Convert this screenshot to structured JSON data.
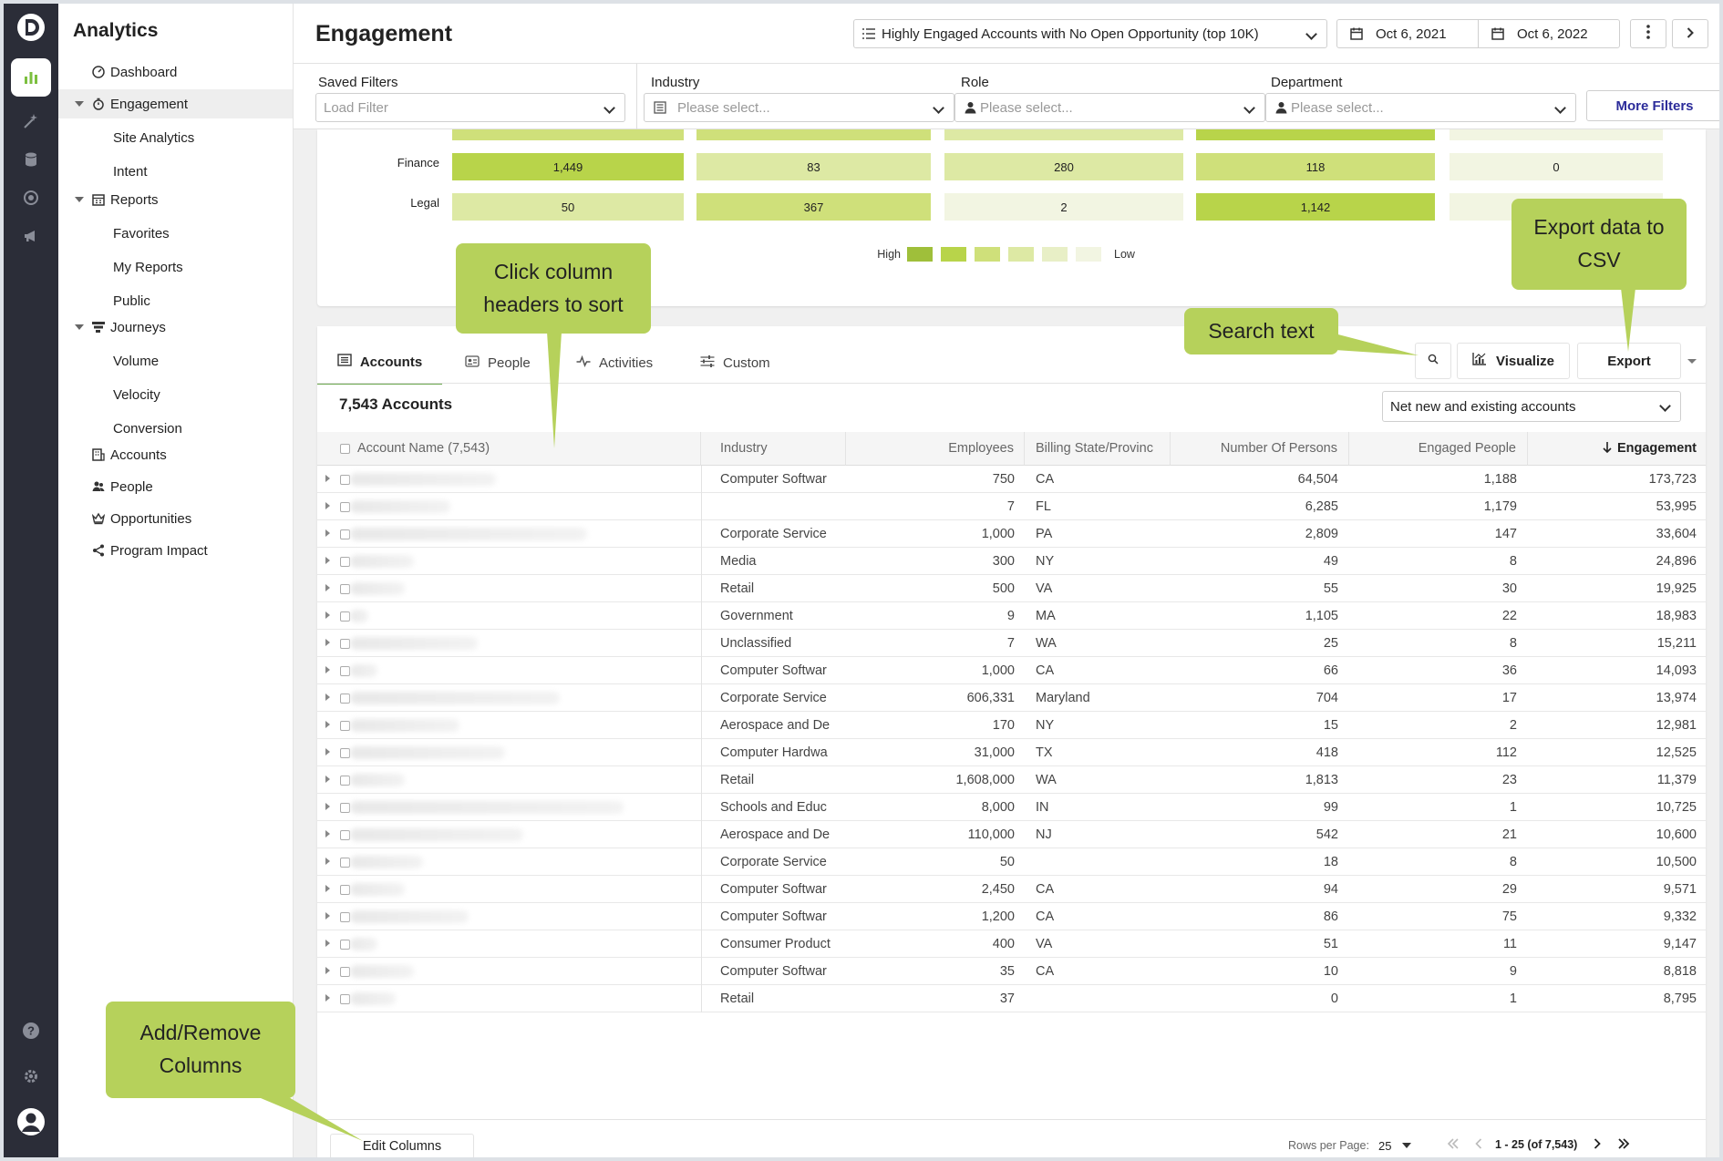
{
  "app": {
    "brand": "Analytics"
  },
  "sidebar": {
    "items": [
      {
        "label": "Dashboard"
      },
      {
        "label": "Engagement"
      },
      {
        "label": "Site Analytics"
      },
      {
        "label": "Intent"
      },
      {
        "label": "Reports"
      },
      {
        "label": "Favorites"
      },
      {
        "label": "My Reports"
      },
      {
        "label": "Public"
      },
      {
        "label": "Journeys"
      },
      {
        "label": "Volume"
      },
      {
        "label": "Velocity"
      },
      {
        "label": "Conversion"
      },
      {
        "label": "Accounts"
      },
      {
        "label": "People"
      },
      {
        "label": "Opportunities"
      },
      {
        "label": "Program Impact"
      }
    ]
  },
  "header": {
    "title": "Engagement",
    "segment": "Highly Engaged Accounts with No Open Opportunity (top 10K)",
    "date_start": "Oct 6, 2021",
    "date_end": "Oct 6, 2022"
  },
  "filters": {
    "saved_label": "Saved Filters",
    "saved_placeholder": "Load Filter",
    "industry_label": "Industry",
    "industry_placeholder": "Please select...",
    "role_label": "Role",
    "role_placeholder": "Please select...",
    "department_label": "Department",
    "department_placeholder": "Please select...",
    "more": "More Filters"
  },
  "heatmap": {
    "rows": [
      {
        "label": "Finance",
        "values": [
          "1,449",
          "83",
          "280",
          "118",
          "0"
        ],
        "levels": [
          2,
          4,
          4,
          3,
          6
        ]
      },
      {
        "label": "Legal",
        "values": [
          "50",
          "367",
          "2",
          "1,142",
          ""
        ],
        "levels": [
          4,
          3,
          6,
          2,
          6
        ]
      }
    ],
    "legend_high": "High",
    "legend_low": "Low",
    "colors": [
      "#9fbf3a",
      "#b8d44a",
      "#cfe07a",
      "#dde9a4",
      "#e8efc6",
      "#f2f5e2"
    ]
  },
  "tabs": [
    {
      "label": "Accounts"
    },
    {
      "label": "People"
    },
    {
      "label": "Activities"
    },
    {
      "label": "Custom"
    }
  ],
  "toolbar": {
    "visualize": "Visualize",
    "export": "Export"
  },
  "table": {
    "count_label": "7,543 Accounts",
    "scope": "Net new and existing accounts",
    "columns": [
      "Account Name (7,543)",
      "Industry",
      "Employees",
      "Billing State/Provinc",
      "Number Of Persons",
      "Engaged People",
      "Engagement"
    ],
    "rows": [
      [
        "Computer Softwar",
        "750",
        "CA",
        "64,504",
        "1,188",
        "173,723"
      ],
      [
        "",
        "7",
        "FL",
        "6,285",
        "1,179",
        "53,995"
      ],
      [
        "Corporate Service",
        "1,000",
        "PA",
        "2,809",
        "147",
        "33,604"
      ],
      [
        "Media",
        "300",
        "NY",
        "49",
        "8",
        "24,896"
      ],
      [
        "Retail",
        "500",
        "VA",
        "55",
        "30",
        "19,925"
      ],
      [
        "Government",
        "9",
        "MA",
        "1,105",
        "22",
        "18,983"
      ],
      [
        "Unclassified",
        "7",
        "WA",
        "25",
        "8",
        "15,211"
      ],
      [
        "Computer Softwar",
        "1,000",
        "CA",
        "66",
        "36",
        "14,093"
      ],
      [
        "Corporate Service",
        "606,331",
        "Maryland",
        "704",
        "17",
        "13,974"
      ],
      [
        "Aerospace and De",
        "170",
        "NY",
        "15",
        "2",
        "12,981"
      ],
      [
        "Computer Hardwa",
        "31,000",
        "TX",
        "418",
        "112",
        "12,525"
      ],
      [
        "Retail",
        "1,608,000",
        "WA",
        "1,813",
        "23",
        "11,379"
      ],
      [
        "Schools and Educ",
        "8,000",
        "IN",
        "99",
        "1",
        "10,725"
      ],
      [
        "Aerospace and De",
        "110,000",
        "NJ",
        "542",
        "21",
        "10,600"
      ],
      [
        "Corporate Service",
        "50",
        "",
        "18",
        "8",
        "10,500"
      ],
      [
        "Computer Softwar",
        "2,450",
        "CA",
        "94",
        "29",
        "9,571"
      ],
      [
        "Computer Softwar",
        "1,200",
        "CA",
        "86",
        "75",
        "9,332"
      ],
      [
        "Consumer Product",
        "400",
        "VA",
        "51",
        "11",
        "9,147"
      ],
      [
        "Computer Softwar",
        "35",
        "CA",
        "10",
        "9",
        "8,818"
      ],
      [
        "Retail",
        "37",
        "",
        "0",
        "1",
        "8,795"
      ]
    ]
  },
  "footer": {
    "edit_columns": "Edit Columns",
    "rows_per_page_label": "Rows per Page:",
    "rows_per_page": "25",
    "range": "1 - 25 (of 7,543)"
  },
  "callouts": {
    "sort": "Click column headers to sort",
    "search": "Search text",
    "export": "Export data to CSV",
    "columns": "Add/Remove Columns"
  },
  "colors": {
    "callout": "#b6d15b",
    "rail": "#2b2d38",
    "accent": "#6ba84f"
  }
}
